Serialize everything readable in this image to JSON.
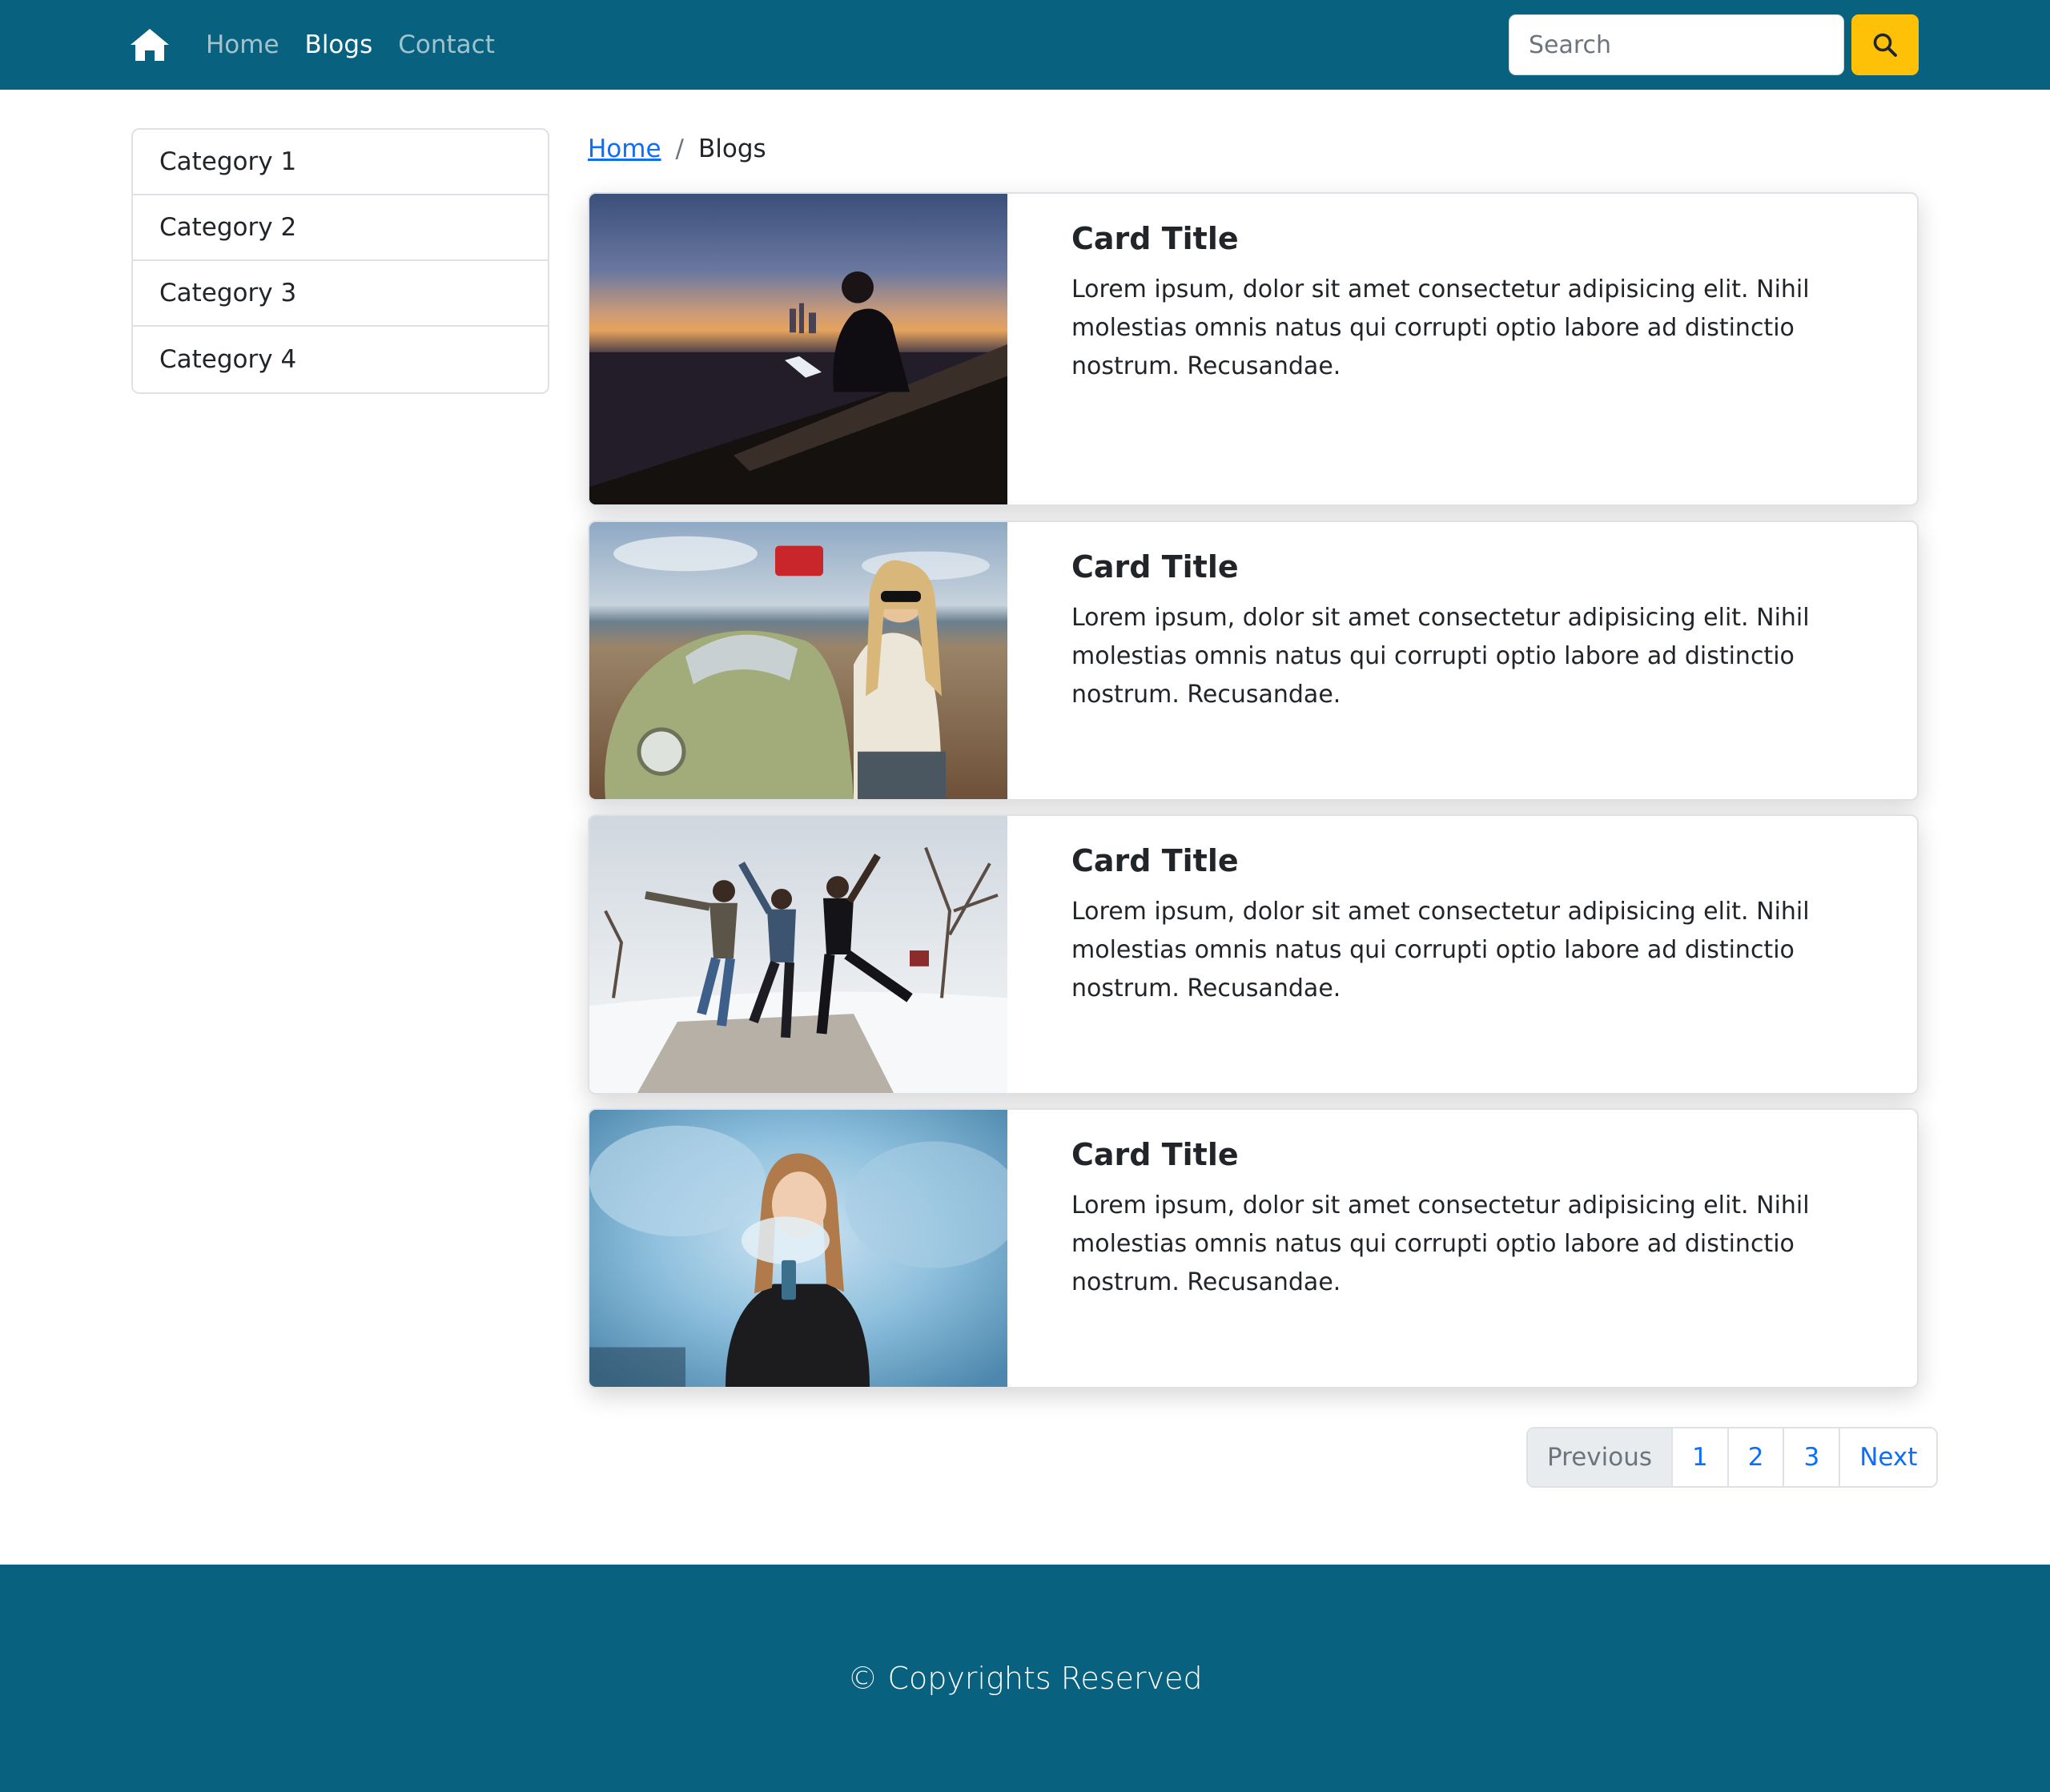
{
  "navbar": {
    "brand_icon": "home-icon",
    "links": [
      {
        "label": "Home",
        "active": false
      },
      {
        "label": "Blogs",
        "active": true
      },
      {
        "label": "Contact",
        "active": false
      }
    ],
    "search": {
      "placeholder": "Search",
      "value": "",
      "button_icon": "search-icon"
    },
    "colors": {
      "background": "#08617e",
      "search_button": "#ffc107"
    }
  },
  "sidebar": {
    "items": [
      {
        "label": "Category 1"
      },
      {
        "label": "Category 2"
      },
      {
        "label": "Category 3"
      },
      {
        "label": "Category 4"
      }
    ]
  },
  "breadcrumb": {
    "items": [
      {
        "label": "Home",
        "link": true
      },
      {
        "label": "Blogs",
        "link": false
      }
    ],
    "separator": "/"
  },
  "cards": [
    {
      "title": "Card Title",
      "text": "Lorem ipsum, dolor sit amet consectetur adipisicing elit. Nihil molestias omnis natus qui corrupti optio labore ad distinctio nostrum. Recusandae.",
      "image": "man-laptop-sunset-photo"
    },
    {
      "title": "Card Title",
      "text": "Lorem ipsum, dolor sit amet consectetur adipisicing elit. Nihil molestias omnis natus qui corrupti optio labore ad distinctio nostrum. Recusandae.",
      "image": "woman-vintage-car-beach-photo"
    },
    {
      "title": "Card Title",
      "text": "Lorem ipsum, dolor sit amet consectetur adipisicing elit. Nihil molestias omnis natus qui corrupti optio labore ad distinctio nostrum. Recusandae.",
      "image": "friends-jumping-snow-photo"
    },
    {
      "title": "Card Title",
      "text": "Lorem ipsum, dolor sit amet consectetur adipisicing elit. Nihil molestias omnis natus qui corrupti optio labore ad distinctio nostrum. Recusandae.",
      "image": "woman-blue-smoke-photo"
    }
  ],
  "pagination": {
    "previous": "Previous",
    "pages": [
      "1",
      "2",
      "3"
    ],
    "next": "Next",
    "previous_disabled": true
  },
  "footer": {
    "text": "© Copyrights Reserved",
    "background": "#08617e"
  }
}
